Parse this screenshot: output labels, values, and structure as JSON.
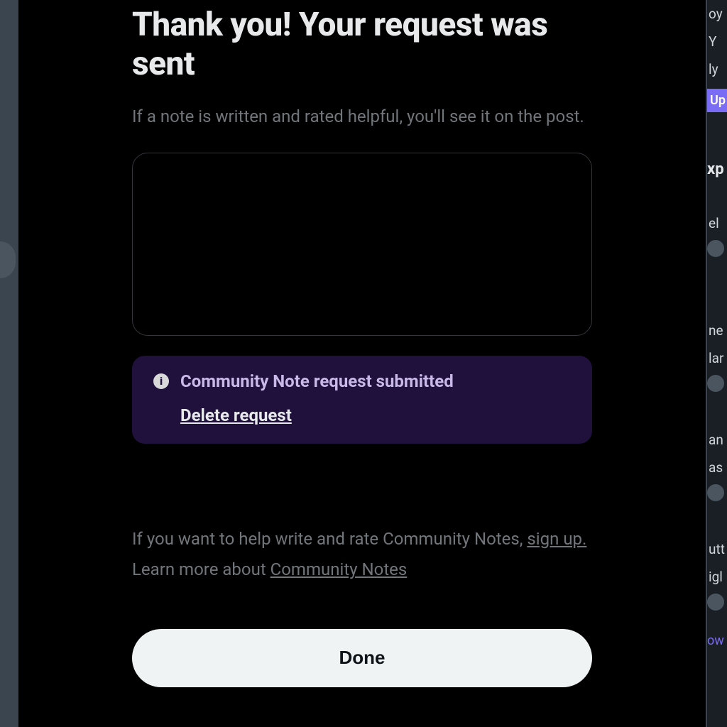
{
  "modal": {
    "title": "Thank you! Your request was sent",
    "subtitle": "If a note is written and rated helpful, you'll see it on the post.",
    "status": {
      "text": "Community Note request submitted",
      "delete_label": "Delete request"
    },
    "help": {
      "prefix": "If you want to help write and rate Community Notes, ",
      "link": "sign up."
    },
    "learn": {
      "prefix": "Learn more about ",
      "link": "Community Notes"
    },
    "done_label": "Done"
  },
  "background": {
    "right": {
      "item1": "oy",
      "item2": "Y",
      "item3": "ly",
      "button": "Up",
      "heading1": "xp",
      "item4": "el",
      "item5": "ne",
      "item6": "lar",
      "item7": "an",
      "item8": "as",
      "item9": "utt",
      "item10": "igl",
      "link": "ow"
    }
  }
}
